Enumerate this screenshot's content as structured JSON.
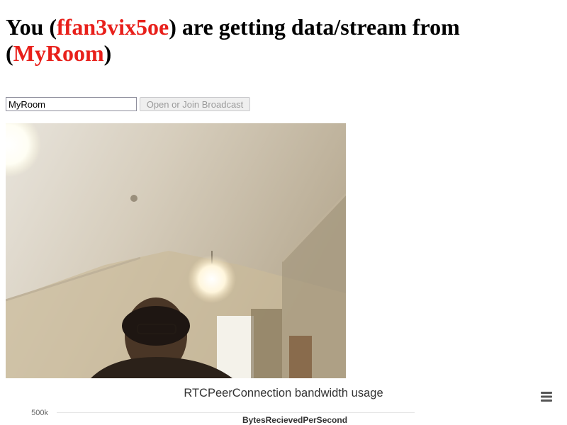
{
  "header": {
    "prefix": "You (",
    "user_id": "ffan3vix5oe",
    "middle": ") are getting data/stream from (",
    "room": "MyRoom",
    "suffix": ")",
    "accent_color": "#e8201b"
  },
  "room_input": {
    "value": "MyRoom"
  },
  "join_button": {
    "label": "Open or Join Broadcast",
    "disabled": true
  },
  "chart_data": {
    "type": "line",
    "title": "RTCPeerConnection bandwidth usage",
    "y_tick_labels": [
      "500k"
    ],
    "series": [
      {
        "name": "BytesRecievedPerSecond",
        "values": []
      }
    ],
    "legend_label": "BytesRecievedPerSecond",
    "grid": true,
    "legend_position": "bottom"
  },
  "icons": {
    "menu": "hamburger-menu-icon"
  }
}
